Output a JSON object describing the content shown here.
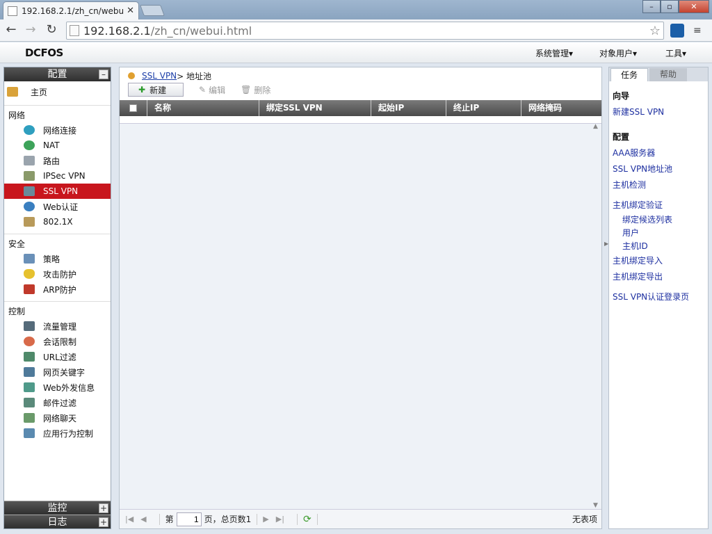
{
  "browser": {
    "tab_title": "192.168.2.1/zh_cn/webu",
    "url_host": "192.168.2.1",
    "url_path": "/zh_cn/webui.html"
  },
  "app": {
    "logo": "DCFOS",
    "topmenu": [
      "系统管理▾",
      "对象用户▾",
      "工具▾"
    ]
  },
  "sidebar": {
    "config_title": "配置",
    "home": "主页",
    "sections": [
      {
        "title": "网络",
        "items": [
          "网络连接",
          "NAT",
          "路由",
          "IPSec VPN",
          "SSL VPN",
          "Web认证",
          "802.1X"
        ]
      },
      {
        "title": "安全",
        "items": [
          "策略",
          "攻击防护",
          "ARP防护"
        ]
      },
      {
        "title": "控制",
        "items": [
          "流量管理",
          "会话限制",
          "URL过滤",
          "网页关键字",
          "Web外发信息",
          "邮件过滤",
          "网络聊天",
          "应用行为控制"
        ]
      }
    ],
    "active_item": "SSL VPN",
    "monitor_title": "监控",
    "log_title": "日志"
  },
  "main": {
    "breadcrumb_link": "SSL VPN",
    "breadcrumb_rest": " > 地址池",
    "btn_new": "新建",
    "btn_edit": "编辑",
    "btn_delete": "删除",
    "columns": [
      "名称",
      "绑定SSL VPN",
      "起始IP",
      "终止IP",
      "网络掩码"
    ],
    "pager": {
      "page_prefix": "第",
      "page_value": "1",
      "page_suffix": "页，总页数1",
      "no_items": "无表项"
    }
  },
  "right": {
    "tab_tasks": "任务",
    "tab_help": "帮助",
    "guide_title": "向导",
    "guide_links": [
      "新建SSL VPN"
    ],
    "config_title": "配置",
    "config_links": [
      "AAA服务器",
      "SSL VPN地址池",
      "主机检测",
      "主机绑定验证"
    ],
    "sub_links": [
      "绑定候选列表",
      "用户",
      "主机ID"
    ],
    "more_links": [
      "主机绑定导入",
      "主机绑定导出"
    ],
    "last_link": "SSL VPN认证登录页"
  }
}
